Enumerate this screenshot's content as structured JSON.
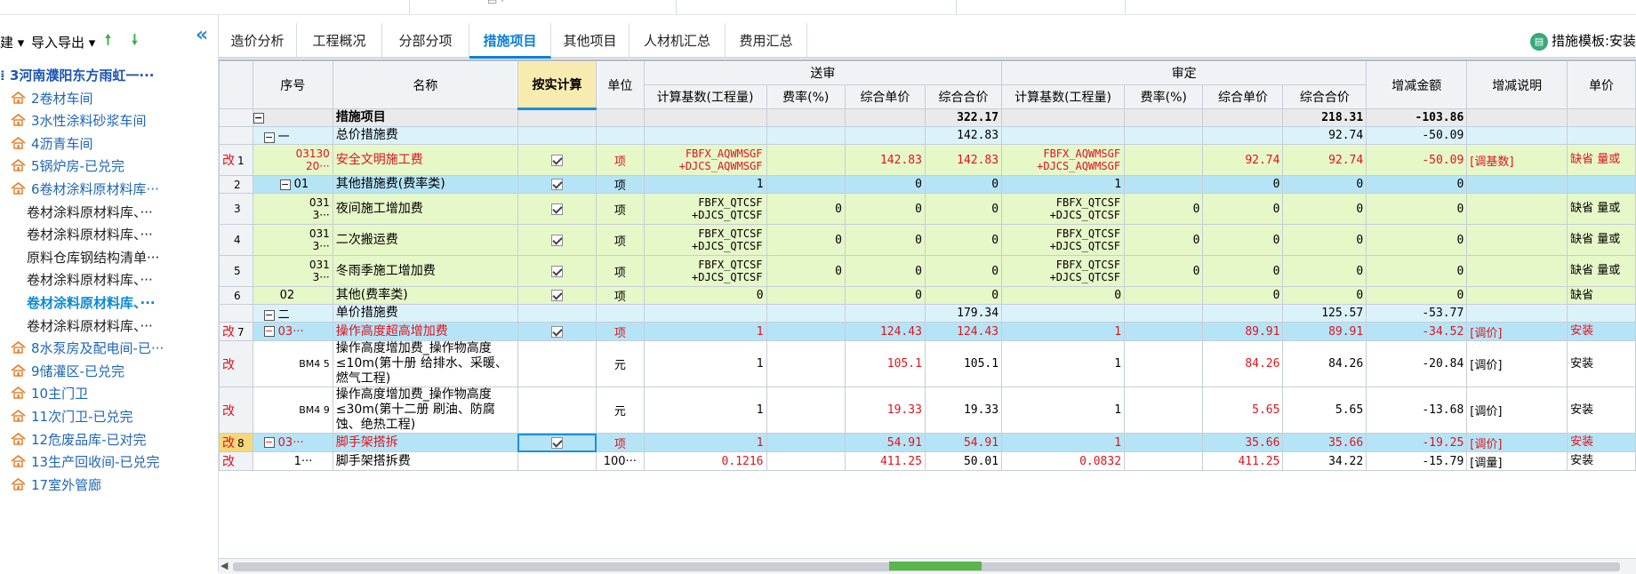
{
  "toolbar": {
    "new_label": "建",
    "import_export_label": "导入导出"
  },
  "tree": {
    "root": "3河南濮阳东方雨虹一···",
    "items": [
      {
        "label": "2卷材车间",
        "type": "house"
      },
      {
        "label": "3水性涂料砂浆车间",
        "type": "house"
      },
      {
        "label": "4沥青车间",
        "type": "house"
      },
      {
        "label": "5锅炉房-已兑完",
        "type": "house"
      },
      {
        "label": "6卷材涂料原材料库···",
        "type": "house"
      },
      {
        "label": "卷材涂料原材料库、···",
        "type": "plain"
      },
      {
        "label": "卷材涂料原材料库、···",
        "type": "plain"
      },
      {
        "label": "原料仓库钢结构清单···",
        "type": "plain"
      },
      {
        "label": "卷材涂料原材料库、···",
        "type": "plain"
      },
      {
        "label": "卷材涂料原材料库、···",
        "type": "selected"
      },
      {
        "label": "卷材涂料原材料库、···",
        "type": "plain"
      },
      {
        "label": "8水泵房及配电间-已···",
        "type": "house"
      },
      {
        "label": "9储灌区-已兑完",
        "type": "house"
      },
      {
        "label": "10主门卫",
        "type": "house"
      },
      {
        "label": "11次门卫-已兑完",
        "type": "house"
      },
      {
        "label": "12危废品库-已对完",
        "type": "house"
      },
      {
        "label": "13生产回收间-已兑完",
        "type": "house"
      },
      {
        "label": "17室外管廊",
        "type": "house"
      }
    ]
  },
  "tabs": [
    "造价分析",
    "工程概况",
    "分部分项",
    "措施项目",
    "其他项目",
    "人材机汇总",
    "费用汇总"
  ],
  "active_tab": "措施项目",
  "template_label": "措施模板:安装",
  "headers": {
    "seq": "序号",
    "name": "名称",
    "by_actual": "按实计算",
    "unit": "单位",
    "submitted": "送审",
    "approved": "审定",
    "base": "计算基数(工程量)",
    "rate": "费率(%)",
    "unit_price": "综合单价",
    "total_price": "综合合价",
    "diff_amount": "增减金额",
    "diff_note": "增减说明",
    "unit_more": "单价"
  },
  "rows": [
    {
      "gutter": "",
      "seq": "",
      "name": "措施项目",
      "unit": "",
      "s_base": "",
      "s_rate": "",
      "s_up": "",
      "s_tp": "322.17",
      "a_base": "",
      "a_rate": "",
      "a_up": "",
      "a_tp": "218.31",
      "diff": "-103.86",
      "note": "",
      "extra": ""
    },
    {
      "gutter": "",
      "seq": "一",
      "name": "总价措施费",
      "unit": "",
      "s_base": "",
      "s_rate": "",
      "s_up": "",
      "s_tp": "142.83",
      "a_base": "",
      "a_rate": "",
      "a_up": "",
      "a_tp": "92.74",
      "diff": "-50.09",
      "note": "",
      "extra": ""
    },
    {
      "gutter": "改",
      "rownum": "1",
      "seq": "03130 20···",
      "name": "安全文明施工费",
      "unit": "项",
      "s_base": "FBFX_AQWMSGF +DJCS_AQWMSGF",
      "s_rate": "",
      "s_up": "142.83",
      "s_tp": "142.83",
      "a_base": "FBFX_AQWMSGF +DJCS_AQWMSGF",
      "a_rate": "",
      "a_up": "92.74",
      "a_tp": "92.74",
      "diff": "-50.09",
      "note": "[调基数]",
      "extra": "缺省 量或"
    },
    {
      "gutter": "",
      "rownum": "2",
      "seq": "01",
      "name": "其他措施费(费率类)",
      "unit": "项",
      "s_base": "1",
      "s_rate": "",
      "s_up": "0",
      "s_tp": "0",
      "a_base": "1",
      "a_rate": "",
      "a_up": "0",
      "a_tp": "0",
      "diff": "0",
      "note": "",
      "extra": ""
    },
    {
      "gutter": "",
      "rownum": "3",
      "seq": "031 3···",
      "name": "夜间施工增加费",
      "unit": "项",
      "s_base": "FBFX_QTCSF +DJCS_QTCSF",
      "s_rate": "0",
      "s_up": "0",
      "s_tp": "0",
      "a_base": "FBFX_QTCSF +DJCS_QTCSF",
      "a_rate": "0",
      "a_up": "0",
      "a_tp": "0",
      "diff": "0",
      "note": "",
      "extra": "缺省 量或"
    },
    {
      "gutter": "",
      "rownum": "4",
      "seq": "031 3···",
      "name": "二次搬运费",
      "unit": "项",
      "s_base": "FBFX_QTCSF +DJCS_QTCSF",
      "s_rate": "0",
      "s_up": "0",
      "s_tp": "0",
      "a_base": "FBFX_QTCSF +DJCS_QTCSF",
      "a_rate": "0",
      "a_up": "0",
      "a_tp": "0",
      "diff": "0",
      "note": "",
      "extra": "缺省 量或"
    },
    {
      "gutter": "",
      "rownum": "5",
      "seq": "031 3···",
      "name": "冬雨季施工增加费",
      "unit": "项",
      "s_base": "FBFX_QTCSF +DJCS_QTCSF",
      "s_rate": "0",
      "s_up": "0",
      "s_tp": "0",
      "a_base": "FBFX_QTCSF +DJCS_QTCSF",
      "a_rate": "0",
      "a_up": "0",
      "a_tp": "0",
      "diff": "0",
      "note": "",
      "extra": "缺省 量或"
    },
    {
      "gutter": "",
      "rownum": "6",
      "seq": "02",
      "name": "其他(费率类)",
      "unit": "项",
      "s_base": "0",
      "s_rate": "",
      "s_up": "0",
      "s_tp": "0",
      "a_base": "0",
      "a_rate": "",
      "a_up": "0",
      "a_tp": "0",
      "diff": "0",
      "note": "",
      "extra": "缺省"
    },
    {
      "gutter": "",
      "seq": "二",
      "name": "单价措施费",
      "unit": "",
      "s_base": "",
      "s_rate": "",
      "s_up": "",
      "s_tp": "179.34",
      "a_base": "",
      "a_rate": "",
      "a_up": "",
      "a_tp": "125.57",
      "diff": "-53.77",
      "note": "",
      "extra": ""
    },
    {
      "gutter": "改",
      "rownum": "7",
      "seq": "03···",
      "name": "操作高度超高增加费",
      "unit": "项",
      "s_base": "1",
      "s_rate": "",
      "s_up": "124.43",
      "s_tp": "124.43",
      "a_base": "1",
      "a_rate": "",
      "a_up": "89.91",
      "a_tp": "89.91",
      "diff": "-34.52",
      "note": "[调价]",
      "extra": "安装"
    },
    {
      "gutter": "改",
      "rownum": "",
      "seq": "BM4 5",
      "name": "操作高度增加费_操作物高度≤10m(第十册 给排水、采暖、燃气工程)",
      "unit": "元",
      "s_base": "1",
      "s_rate": "",
      "s_up": "105.1",
      "s_tp": "105.1",
      "a_base": "1",
      "a_rate": "",
      "a_up": "84.26",
      "a_tp": "84.26",
      "diff": "-20.84",
      "note": "[调价]",
      "extra": "安装"
    },
    {
      "gutter": "改",
      "rownum": "",
      "seq": "BM4 9",
      "name": "操作高度增加费_操作物高度≤30m(第十二册 刷油、防腐蚀、绝热工程)",
      "unit": "元",
      "s_base": "1",
      "s_rate": "",
      "s_up": "19.33",
      "s_tp": "19.33",
      "a_base": "1",
      "a_rate": "",
      "a_up": "5.65",
      "a_tp": "5.65",
      "diff": "-13.68",
      "note": "[调价]",
      "extra": "安装"
    },
    {
      "gutter": "改",
      "rownum": "8",
      "seq": "03···",
      "name": "脚手架搭拆",
      "unit": "项",
      "s_base": "1",
      "s_rate": "",
      "s_up": "54.91",
      "s_tp": "54.91",
      "a_base": "1",
      "a_rate": "",
      "a_up": "35.66",
      "a_tp": "35.66",
      "diff": "-19.25",
      "note": "[调价]",
      "extra": "安装"
    },
    {
      "gutter": "改",
      "rownum": "",
      "seq": "1···",
      "name": "脚手架搭拆费",
      "unit": "100···",
      "s_base": "0.1216",
      "s_rate": "",
      "s_up": "411.25",
      "s_tp": "50.01",
      "a_base": "0.0832",
      "a_rate": "",
      "a_up": "411.25",
      "a_tp": "34.22",
      "diff": "-15.79",
      "note": "[调量]",
      "extra": "安装"
    }
  ]
}
